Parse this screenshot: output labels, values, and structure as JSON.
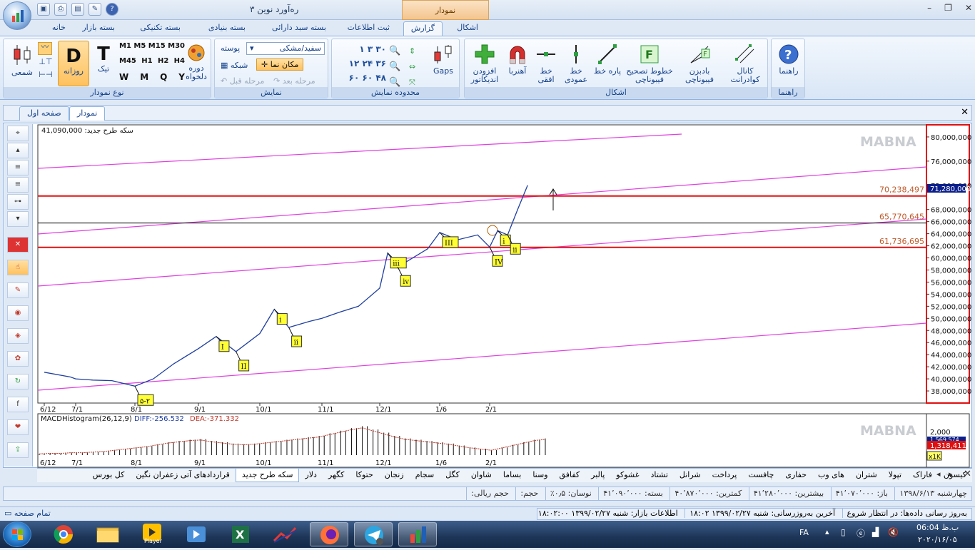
{
  "window": {
    "title": "ره‌آورد نوین ۳",
    "context_tab": "نمودار"
  },
  "ribbon_tabs": [
    "خانه",
    "بسته بازار",
    "بسته تکنیکی",
    "بسته بنیادی",
    "بسته سبد دارائی",
    "ثبت اطلاعات",
    "گزارش",
    "اشکال"
  ],
  "active_ribbon_tab": "گزارش",
  "groups": {
    "chart_type": {
      "label": "نوع نمودار",
      "candle": "شمعی",
      "daily": "روزانه",
      "tick": "تیک",
      "period": "دوره دلخواه",
      "tf_m1": "M1",
      "tf_m5": "M5",
      "tf_m15": "M15",
      "tf_m30": "M30",
      "tf_m45": "M45",
      "tf_h1": "H1",
      "tf_h2": "H2",
      "tf_h4": "H4",
      "tf_w": "W",
      "tf_mo": "M",
      "tf_q": "Q",
      "tf_y": "Y"
    },
    "display": {
      "label": "نمایش",
      "skin_label": "پوسته",
      "skin_value": "سفید/مشکی",
      "grid": "شبکه",
      "cursor": "مکان نما",
      "prev": "مرحله قبل",
      "next": "مرحله بعد"
    },
    "range": {
      "label": "محدوده نمایش",
      "nums": [
        "۳۰",
        "۳",
        "۱",
        "۳۶",
        "۲۴",
        "۱۲",
        "۴۸",
        "۶۰",
        "۶۰"
      ],
      "gaps": "Gaps"
    },
    "shapes": {
      "label": "اشکال",
      "add_indicator": "افزودن اندیکاتور",
      "magnet": "آهنربا",
      "hline": "خط افقی",
      "vline": "خط عمودی",
      "segment": "پاره خط",
      "fib_fix": "خطوط تصحیح فیبوناچی",
      "fib_fan": "بادبزن فیبوناچی",
      "quad_channel": "کانال کوادرانت"
    },
    "help": {
      "label": "راهنما",
      "help": "راهنما"
    }
  },
  "doc_tabs": [
    "صفحه اول",
    "نمودار"
  ],
  "active_doc_tab": "نمودار",
  "chart_data": {
    "type": "line",
    "symbol_label": "سکه طرح جدید: 41,090,000",
    "watermark": "MABNA",
    "x_ticks": [
      "6/12",
      "7/1",
      "8/1",
      "9/1",
      "10/1",
      "11/1",
      "12/1",
      "1/6",
      "2/1"
    ],
    "y_ticks": [
      "80,000,000",
      "76,000,000",
      "72,000,000",
      "68,000,000",
      "66,000,000",
      "64,000,000",
      "62,000,000",
      "60,000,000",
      "58,000,000",
      "56,000,000",
      "54,000,000",
      "52,000,000",
      "50,000,000",
      "48,000,000",
      "46,000,000",
      "44,000,000",
      "42,000,000",
      "40,000,000",
      "38,000,000"
    ],
    "last_price": "71,280,000",
    "levels": [
      {
        "label": "70,238,497",
        "value": 70238497,
        "color": "#e01010"
      },
      {
        "label": "65,770,645",
        "value": 65770645,
        "color": "#000000"
      },
      {
        "label": "61,736,695",
        "value": 61736695,
        "color": "#e01010"
      }
    ],
    "series": [
      {
        "x": [
          "6/12",
          "6/20",
          "7/1",
          "7/10",
          "7/20",
          "8/1",
          "8/10",
          "8/20",
          "9/1",
          "9/10",
          "9/20",
          "10/1",
          "10/8",
          "10/15",
          "10/25",
          "11/1",
          "11/10",
          "11/20",
          "12/1",
          "12/5",
          "12/10",
          "12/15",
          "12/25",
          "1/6",
          "1/15",
          "1/25",
          "2/1",
          "2/5",
          "2/10",
          "2/15",
          "2/20"
        ],
        "values": [
          41090000,
          40300000,
          40000000,
          39800000,
          39700000,
          38800000,
          40000000,
          42500000,
          45000000,
          47000000,
          44500000,
          47500000,
          51500000,
          48500000,
          49500000,
          50000000,
          51000000,
          52000000,
          55000000,
          60800000,
          58500000,
          59500000,
          61500000,
          64200000,
          63000000,
          63800000,
          61800000,
          64500000,
          63800000,
          68000000,
          72000000
        ]
      }
    ],
    "wave_labels": [
      "۵-۲",
      "I",
      "II",
      "i",
      "ii",
      "iii",
      "iv",
      "III",
      "IV",
      "i",
      "ii"
    ],
    "ylim": [
      36000000,
      82000000
    ]
  },
  "macd": {
    "title": "MACDHistogram(26,12,9)",
    "diff": "DIFF:-256.532",
    "dea": "DEA:-371.332",
    "axis_top": "2,000",
    "blue_value": "1,569,574",
    "red_value": "1,318,411",
    "badge": "x1K",
    "hist": [
      2,
      3,
      3,
      4,
      4,
      5,
      6,
      8,
      10,
      12,
      14,
      17,
      20,
      22,
      24,
      25,
      22,
      20,
      18,
      17,
      18,
      20,
      22,
      24,
      26,
      28,
      30,
      34,
      38,
      42,
      45,
      40,
      35,
      30,
      26,
      24,
      22,
      20,
      18,
      15,
      12,
      10,
      8,
      12,
      16,
      20,
      24,
      26
    ]
  },
  "symbol_tabs": [
    "کیسون",
    "فاراک",
    "تپولا",
    "شتران",
    "های وب",
    "حفاری",
    "چافست",
    "پرداخت",
    "شرانل",
    "تشتاد",
    "غشوکو",
    "پالبر",
    "کفافق",
    "وسنا",
    "بساما",
    "شاوان",
    "کگل",
    "سجام",
    "زنجان",
    "حتوکا",
    "کگهر",
    "دلار",
    "سکه طرح جدید",
    "قراردادهای آتی زعفران نگین",
    "کل بورس"
  ],
  "active_symbol_tab": "سکه طرح جدید",
  "info": [
    "چهارشنبه ۱۳۹۸/۶/۱۳",
    "باز: ۴۱٬۰۷۰٬۰۰۰",
    "بیشترین: ۴۱٬۲۸۰٬۰۰۰",
    "کمترین: ۴۰٬۸۷۰٬۰۰۰",
    "بسته: ۴۱٬۰۹۰٬۰۰۰",
    "نوسان: ۰٫۵٪",
    "حجم:",
    "حجم ریالی:"
  ],
  "status": {
    "left": "تمام صفحه",
    "update": "به‌روز رسانی داده‌ها: در انتظار شروع",
    "last_update": "آخرین به‌روزرسانی: شنبه ۱۳۹۹/۰۲/۲۷ ۱۸:۰۲",
    "market": "اطلاعات بازار: شنبه ۱۳۹۹/۰۲/۲۷ ۱۸:۰۲:۰۰"
  },
  "taskbar": {
    "lang": "FA",
    "time": "ب.ظ 06:04",
    "date": "۲۰۲۰/۱۶/۰۵",
    "player": "Player"
  }
}
